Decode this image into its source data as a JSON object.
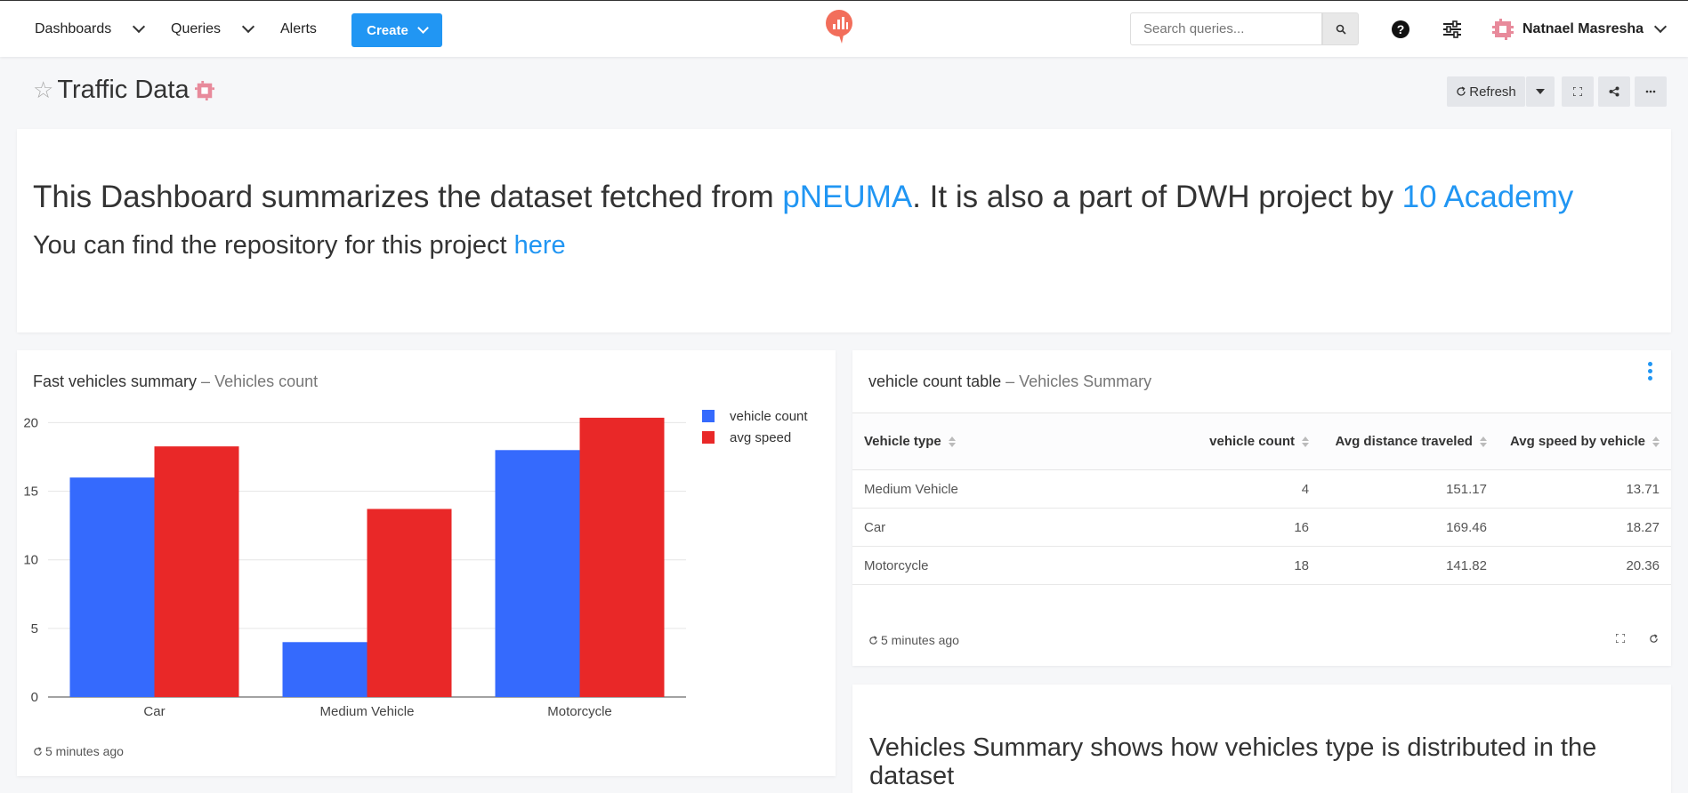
{
  "nav": {
    "dashboards": "Dashboards",
    "queries": "Queries",
    "alerts": "Alerts",
    "create": "Create",
    "search_placeholder": "Search queries...",
    "user_name": "Natnael Masresha"
  },
  "header": {
    "title": "Traffic Data",
    "refresh": "Refresh"
  },
  "intro": {
    "line1_prefix": "This Dashboard summarizes the dataset fetched from ",
    "line1_link1": "pNEUMA",
    "line1_mid": ". It is also a part of DWH project by ",
    "line1_link2": "10 Academy",
    "line2_prefix": "You can find the repository for this project ",
    "line2_link": "here"
  },
  "chart_widget": {
    "title": "Fast vehicles summary",
    "separator": " – ",
    "subtitle": "Vehicles count",
    "updated": "5 minutes ago"
  },
  "chart_data": {
    "type": "bar",
    "categories": [
      "Car",
      "Medium Vehicle",
      "Motorcycle"
    ],
    "series": [
      {
        "name": "vehicle count",
        "values": [
          16,
          4,
          18
        ],
        "color": "#356afd"
      },
      {
        "name": "avg speed",
        "values": [
          18.27,
          13.71,
          20.36
        ],
        "color": "#e92828"
      }
    ],
    "yticks": [
      0,
      5,
      10,
      15,
      20
    ],
    "ylim": [
      0,
      21
    ],
    "legend_position": "right"
  },
  "table_widget": {
    "title": "vehicle count table",
    "separator": " – ",
    "subtitle": "Vehicles Summary",
    "updated": "5 minutes ago",
    "columns": [
      "Vehicle type",
      "vehicle count",
      "Avg distance traveled",
      "Avg speed by vehicle"
    ],
    "rows": [
      [
        "Medium Vehicle",
        "4",
        "151.17",
        "13.71"
      ],
      [
        "Car",
        "16",
        "169.46",
        "18.27"
      ],
      [
        "Motorcycle",
        "18",
        "141.82",
        "20.36"
      ]
    ]
  },
  "text_widget": {
    "text": "Vehicles Summary shows how vehicles type is distributed in the dataset"
  }
}
